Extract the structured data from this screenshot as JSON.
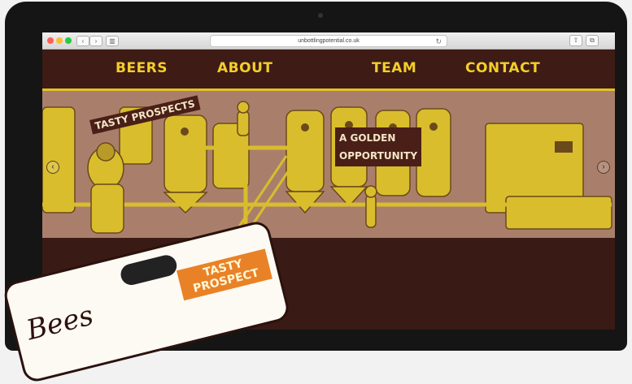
{
  "browser": {
    "url": "unbottlingpotential.co.uk",
    "back_icon": "chevron-left",
    "forward_icon": "chevron-right",
    "sidebar_icon": "sidebar",
    "reload_icon": "reload",
    "share_icon": "share",
    "tabs_icon": "tabs",
    "traffic_lights": [
      "#ff5f57",
      "#febc2e",
      "#28c840"
    ]
  },
  "nav": {
    "items": [
      {
        "label": "BEERS"
      },
      {
        "label": "ABOUT"
      },
      {
        "label": "TEAM"
      },
      {
        "label": "CONTACT"
      }
    ]
  },
  "banner": {
    "speech_1": "TASTY PROSPECTS",
    "speech_2_line_1": "A GOLDEN",
    "speech_2_line_2": "OPPORTUNITY",
    "prev_icon": "chevron-left",
    "next_icon": "chevron-right"
  },
  "card": {
    "script": "Bees",
    "label_line_1": "TASTY",
    "label_line_2": "PROSPECT"
  },
  "colors": {
    "brand_dark": "#3e1b15",
    "brand_yellow": "#f2cf2a",
    "banner_bg": "#a97f6c",
    "label_orange": "#e98226"
  }
}
